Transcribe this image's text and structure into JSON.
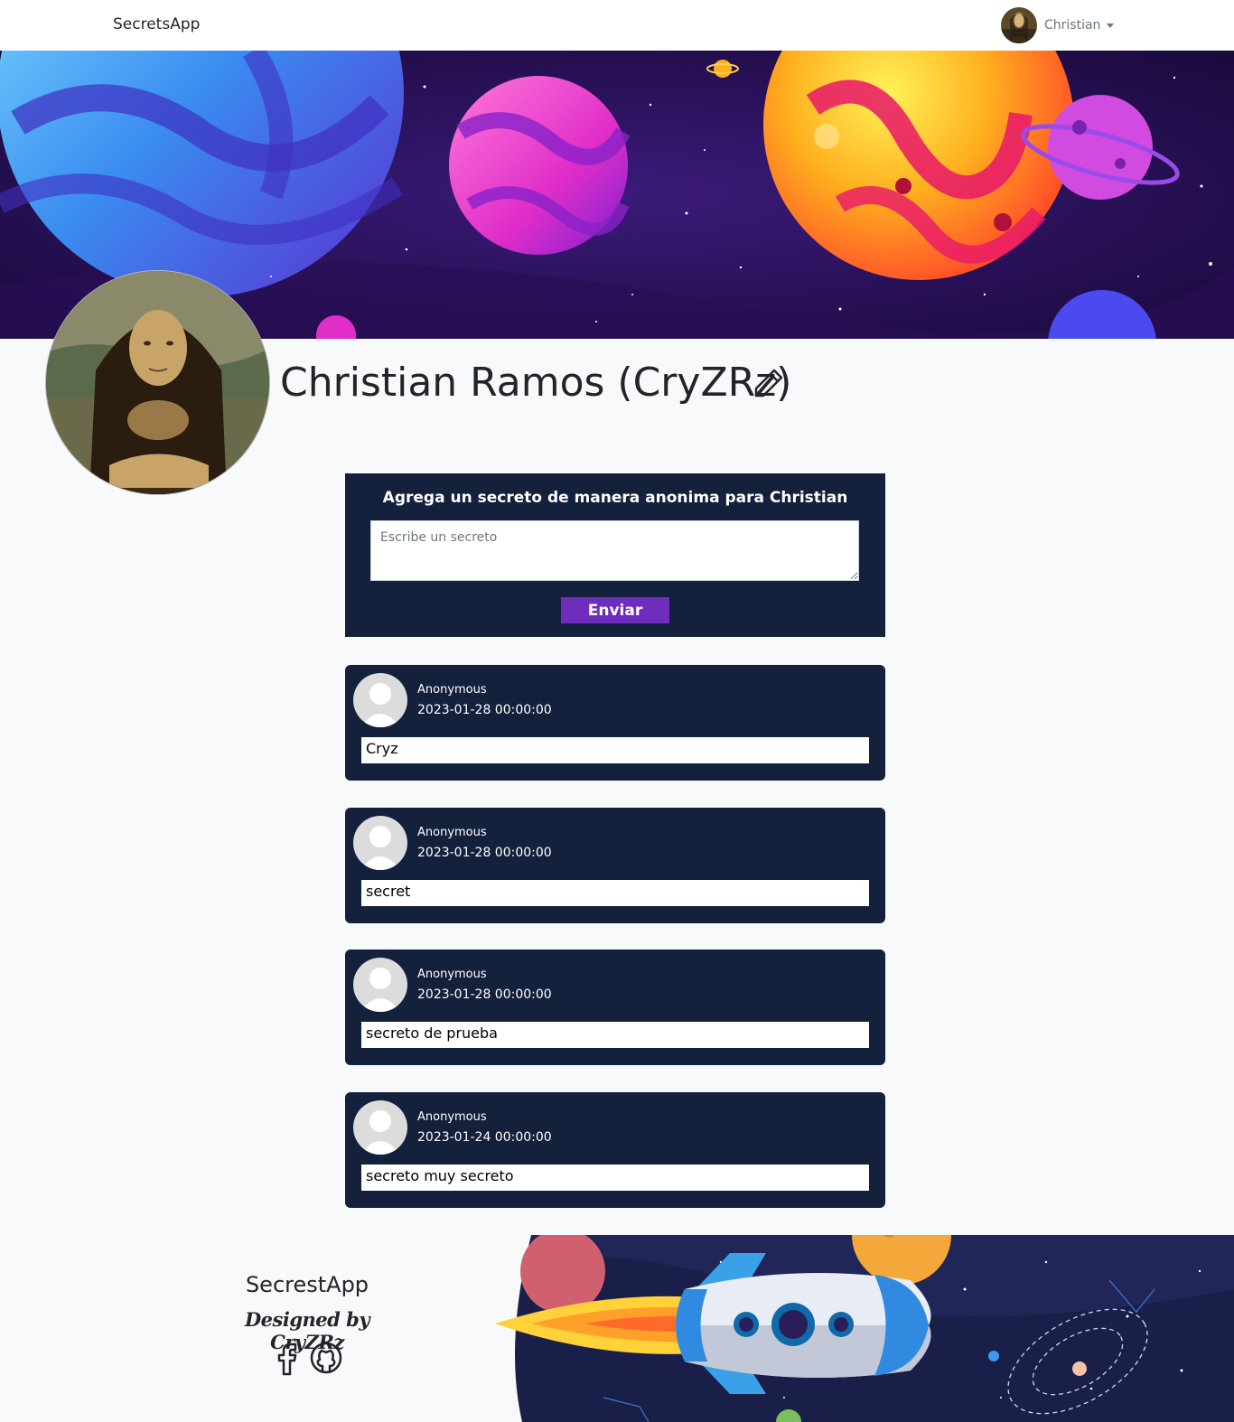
{
  "navbar": {
    "brand": "SecretsApp",
    "user_name": "Christian",
    "avatar_icon": "user-avatar-icon",
    "dropdown_icon": "caret-down-icon"
  },
  "profile": {
    "name": "Christian Ramos (CryZRz)",
    "edit_icon": "pencil-icon"
  },
  "form": {
    "title": "Agrega un secreto de manera anonima para Christian",
    "placeholder": "Escribe un secreto",
    "value": "",
    "submit_label": "Enviar"
  },
  "secrets": [
    {
      "author": "Anonymous",
      "date": "2023-01-28 00:00:00",
      "text": "Cryz"
    },
    {
      "author": "Anonymous",
      "date": "2023-01-28 00:00:00",
      "text": "secret"
    },
    {
      "author": "Anonymous",
      "date": "2023-01-28 00:00:00",
      "text": "secreto de prueba"
    },
    {
      "author": "Anonymous",
      "date": "2023-01-24 00:00:00",
      "text": "secreto muy secreto"
    }
  ],
  "footer": {
    "title": "SecrestApp",
    "designer": "Designed by CryZRz",
    "social": [
      {
        "icon": "facebook-icon"
      },
      {
        "icon": "github-icon"
      }
    ]
  },
  "colors": {
    "card_bg": "#13213c",
    "accent": "#6f2dbd",
    "page_bg": "#f8f9fa"
  }
}
